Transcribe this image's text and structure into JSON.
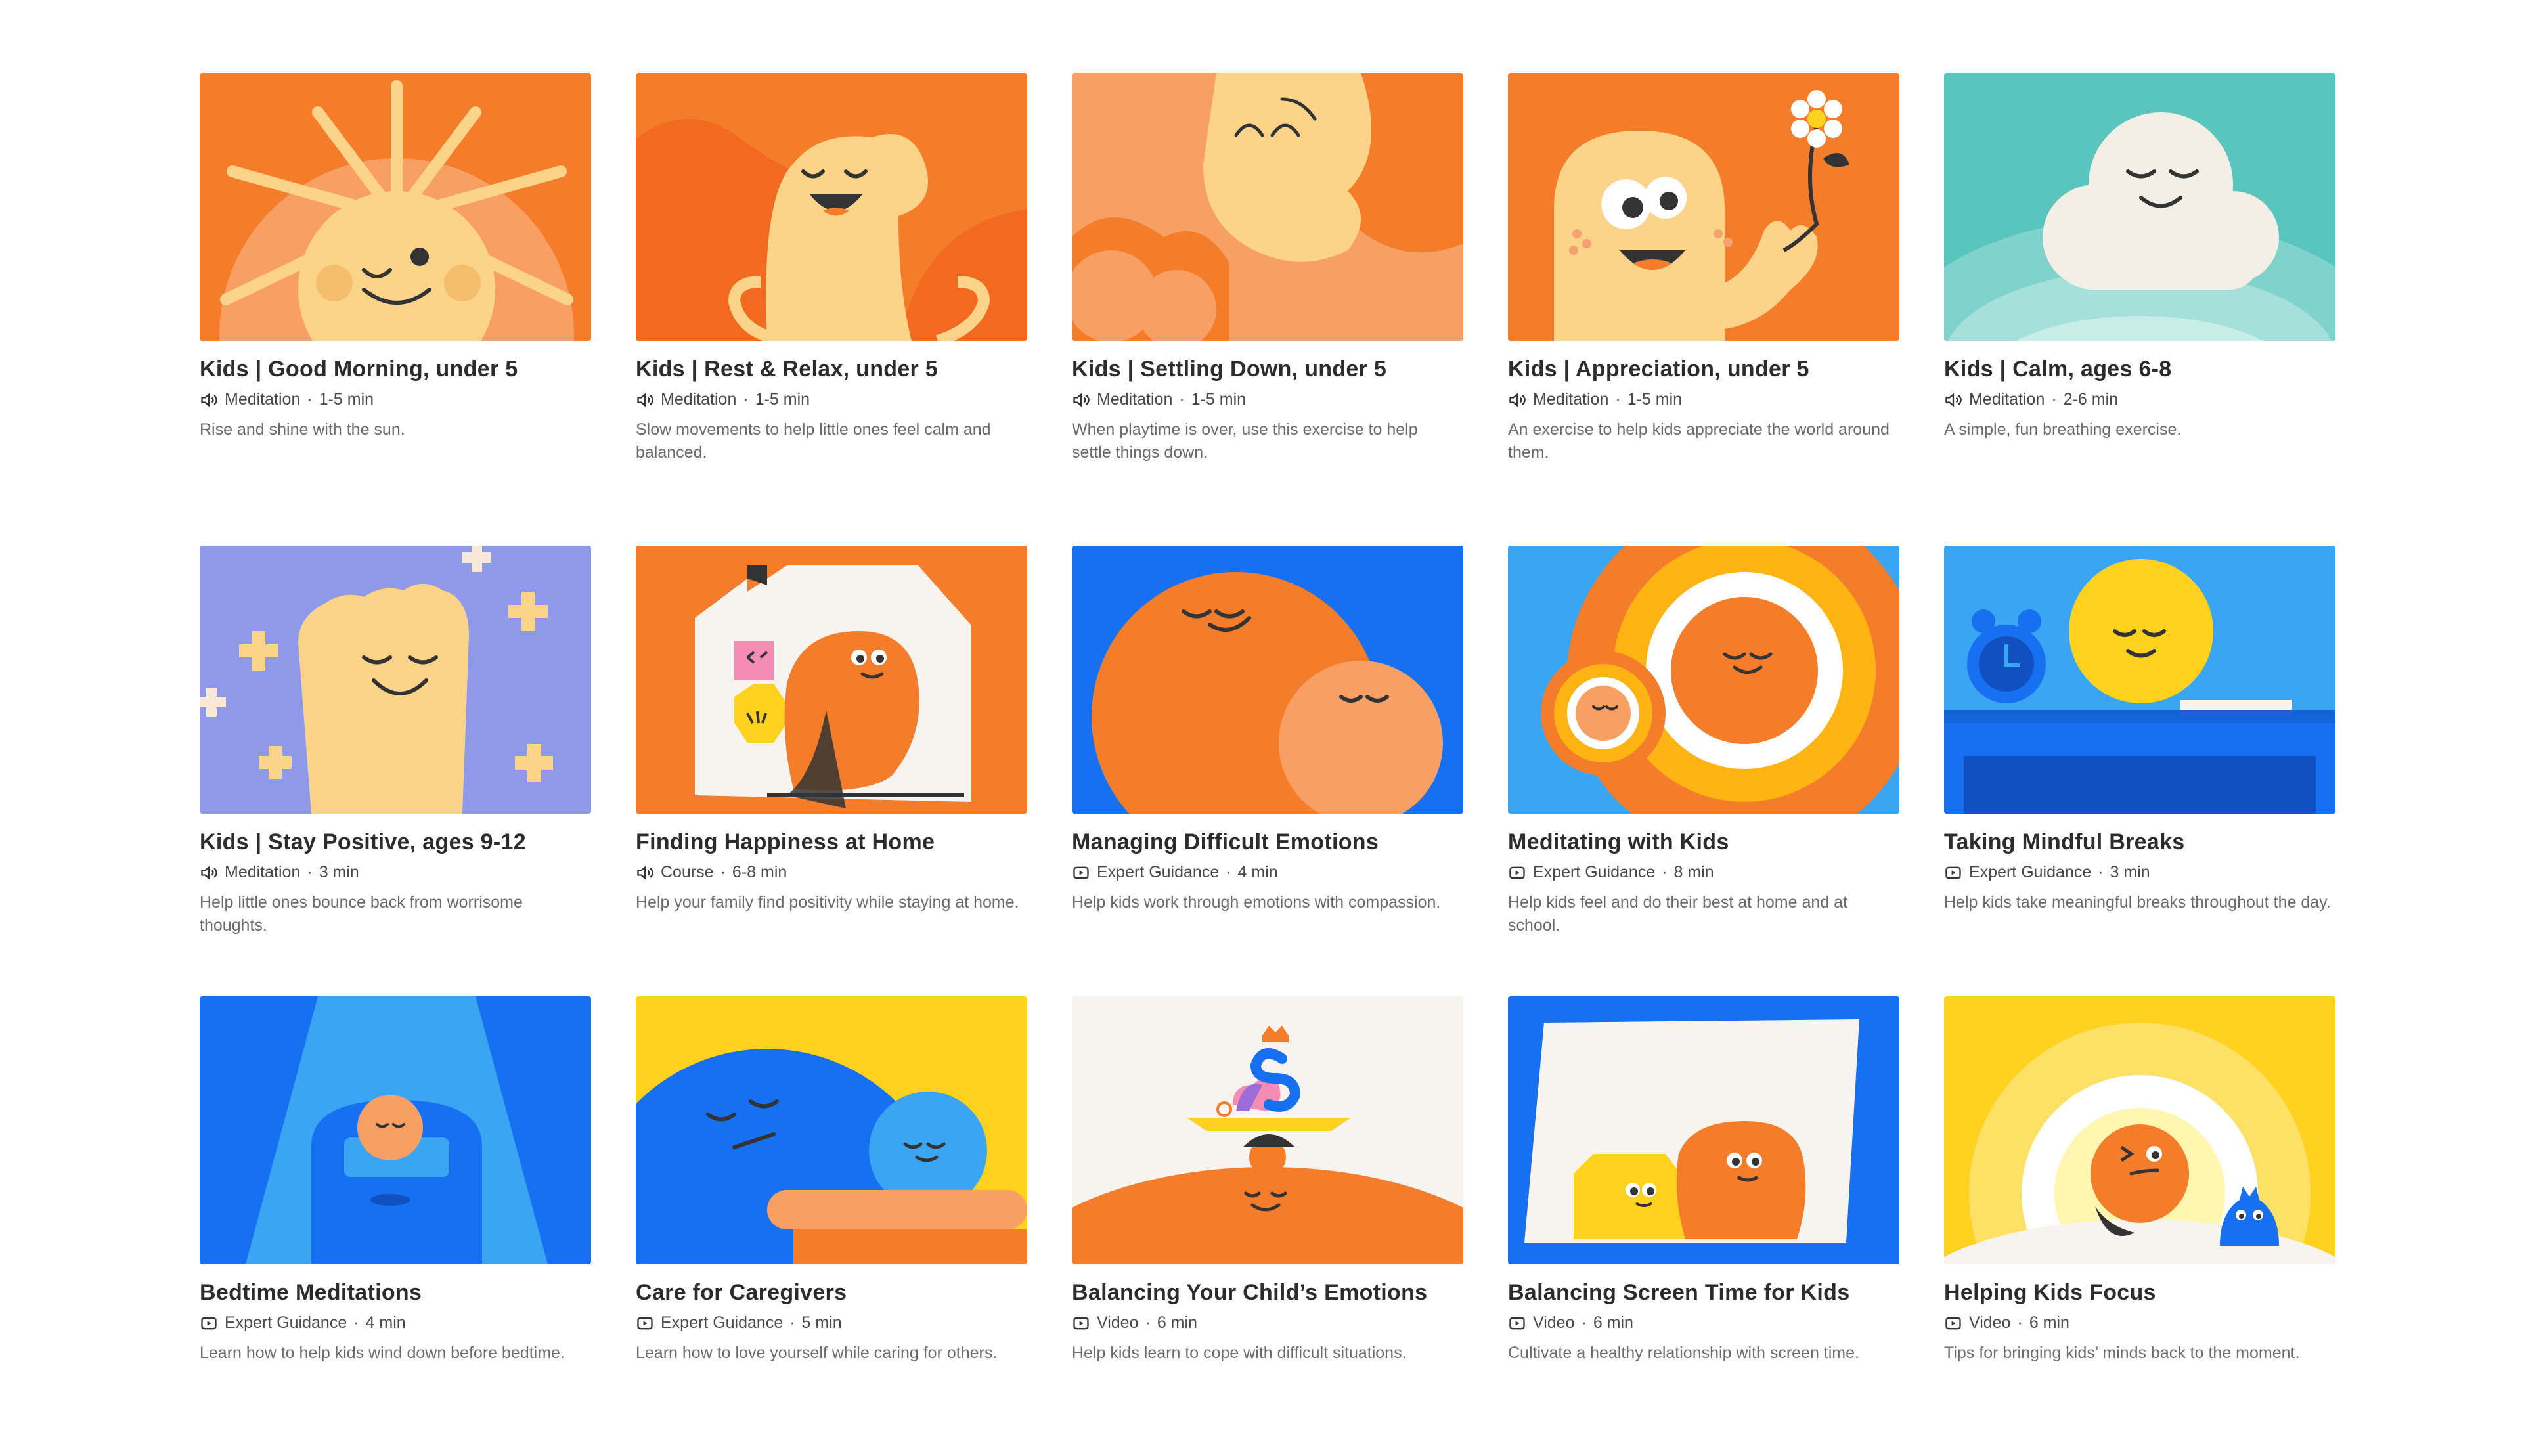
{
  "cards": [
    {
      "title": "Kids | Good Morning, under 5",
      "type": "Meditation",
      "duration": "1-5 min",
      "description": "Rise and shine with the sun.",
      "icon": "speaker-icon"
    },
    {
      "title": "Kids | Rest & Relax, under 5",
      "type": "Meditation",
      "duration": "1-5 min",
      "description": "Slow movements to help little ones feel calm and balanced.",
      "icon": "speaker-icon"
    },
    {
      "title": "Kids | Settling Down, under 5",
      "type": "Meditation",
      "duration": "1-5 min",
      "description": "When playtime is over, use this exercise to help settle things down.",
      "icon": "speaker-icon"
    },
    {
      "title": "Kids | Appreciation, under 5",
      "type": "Meditation",
      "duration": "1-5 min",
      "description": "An exercise to help kids appreciate the world around them.",
      "icon": "speaker-icon"
    },
    {
      "title": "Kids | Calm, ages 6-8",
      "type": "Meditation",
      "duration": "2-6 min",
      "description": "A simple, fun breathing exercise.",
      "icon": "speaker-icon"
    },
    {
      "title": "Kids | Stay Positive, ages 9-12",
      "type": "Meditation",
      "duration": "3 min",
      "description": "Help little ones bounce back from worrisome thoughts.",
      "icon": "speaker-icon"
    },
    {
      "title": "Finding Happiness at Home",
      "type": "Course",
      "duration": "6-8 min",
      "description": "Help your family find positivity while staying at home.",
      "icon": "speaker-icon"
    },
    {
      "title": "Managing Difficult Emotions",
      "type": "Expert Guidance",
      "duration": "4 min",
      "description": "Help kids work through emotions with compassion.",
      "icon": "play-icon"
    },
    {
      "title": "Meditating with Kids",
      "type": "Expert Guidance",
      "duration": "8 min",
      "description": "Help kids feel and do their best at home and at school.",
      "icon": "play-icon"
    },
    {
      "title": "Taking Mindful Breaks",
      "type": "Expert Guidance",
      "duration": "3 min",
      "description": "Help kids take meaningful breaks throughout the day.",
      "icon": "play-icon"
    },
    {
      "title": "Bedtime Meditations",
      "type": "Expert Guidance",
      "duration": "4 min",
      "description": "Learn how to help kids wind down before bedtime.",
      "icon": "play-icon"
    },
    {
      "title": "Care for Caregivers",
      "type": "Expert Guidance",
      "duration": "5 min",
      "description": "Learn how to love yourself while caring for others.",
      "icon": "play-icon"
    },
    {
      "title": "Balancing Your Child’s Emotions",
      "type": "Video",
      "duration": "6 min",
      "description": "Help kids learn to cope with difficult situations.",
      "icon": "play-icon"
    },
    {
      "title": "Balancing Screen Time for Kids",
      "type": "Video",
      "duration": "6 min",
      "description": "Cultivate a healthy relationship with screen time.",
      "icon": "play-icon"
    },
    {
      "title": "Helping Kids Focus",
      "type": "Video",
      "duration": "6 min",
      "description": "Tips for bringing kids’ minds back to the moment.",
      "icon": "play-icon"
    }
  ],
  "separator": " · ",
  "colors": {
    "orange": "#f47d2c",
    "light_orange": "#f8a064",
    "peach": "#fbd48a",
    "teal": "#5ac5bd",
    "lavender": "#8e9ae8",
    "blue": "#1670f0",
    "sky": "#3aa5f2",
    "yellow": "#ffd21f",
    "cream": "#f7f3ee"
  }
}
